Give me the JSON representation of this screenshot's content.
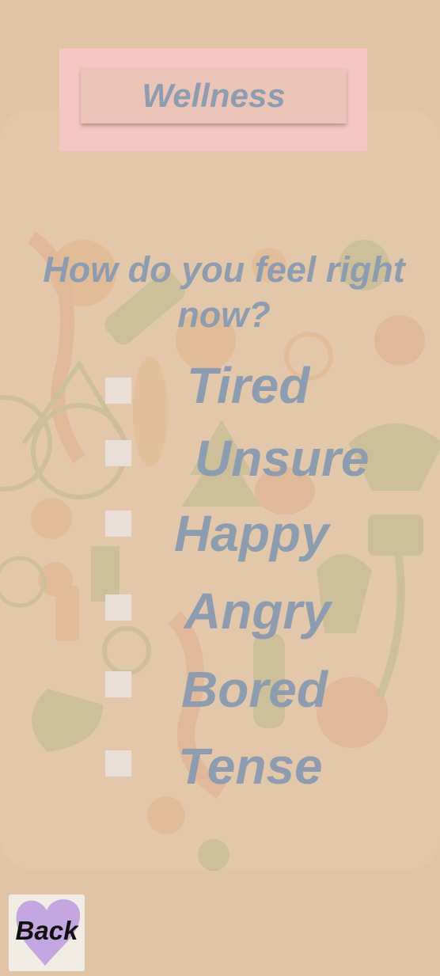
{
  "header": {
    "title": "Wellness"
  },
  "question": "How do you feel right now?",
  "options": [
    {
      "label": "Tired",
      "checked": false
    },
    {
      "label": "Unsure",
      "checked": false
    },
    {
      "label": "Happy",
      "checked": false
    },
    {
      "label": "Angry",
      "checked": false
    },
    {
      "label": "Bored",
      "checked": false
    },
    {
      "label": "Tense",
      "checked": false
    }
  ],
  "back": {
    "label": "Back",
    "icon": "heart-icon"
  },
  "colors": {
    "background": "#dfc4a6",
    "header_frame": "#f4c7c3",
    "title_button": "#eac4b6",
    "text": "#8e9cb0",
    "checkbox": "#e9dfd6",
    "heart": "#c4a7e0"
  }
}
